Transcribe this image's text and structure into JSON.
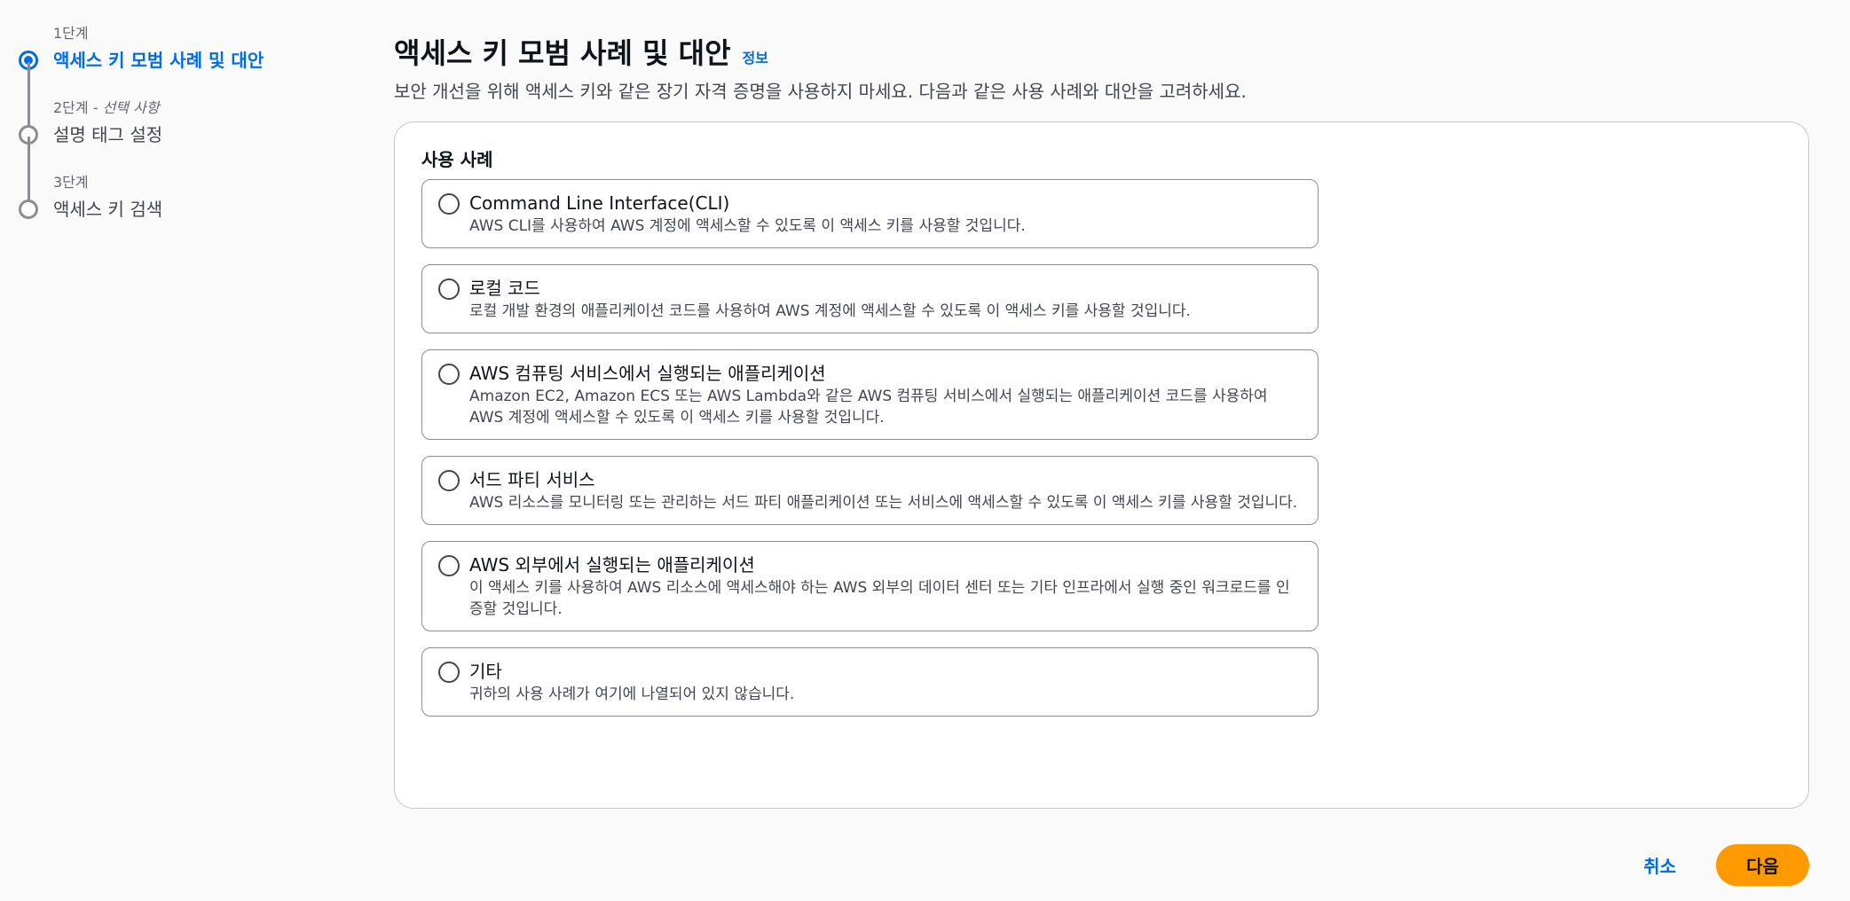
{
  "wizard": {
    "steps": [
      {
        "number": "1단계",
        "optional": "",
        "title": "액세스 키 모범 사례 및 대안",
        "active": true
      },
      {
        "number": "2단계",
        "optional": "선택 사항",
        "title": "설명 태그 설정",
        "active": false
      },
      {
        "number": "3단계",
        "optional": "",
        "title": "액세스 키 검색",
        "active": false
      }
    ]
  },
  "header": {
    "title": "액세스 키 모범 사례 및 대안",
    "info_link": "정보",
    "description": "보안 개선을 위해 액세스 키와 같은 장기 자격 증명을 사용하지 마세요. 다음과 같은 사용 사례와 대안을 고려하세요."
  },
  "use_cases": {
    "label": "사용 사례",
    "options": [
      {
        "title": "Command Line Interface(CLI)",
        "description": "AWS CLI를 사용하여 AWS 계정에 액세스할 수 있도록 이 액세스 키를 사용할 것입니다."
      },
      {
        "title": "로컬 코드",
        "description": "로컬 개발 환경의 애플리케이션 코드를 사용하여 AWS 계정에 액세스할 수 있도록 이 액세스 키를 사용할 것입니다."
      },
      {
        "title": "AWS 컴퓨팅 서비스에서 실행되는 애플리케이션",
        "description": "Amazon EC2, Amazon ECS 또는 AWS Lambda와 같은 AWS 컴퓨팅 서비스에서 실행되는 애플리케이션 코드를 사용하여 AWS 계정에 액세스할 수 있도록 이 액세스 키를 사용할 것입니다."
      },
      {
        "title": "서드 파티 서비스",
        "description": "AWS 리소스를 모니터링 또는 관리하는 서드 파티 애플리케이션 또는 서비스에 액세스할 수 있도록 이 액세스 키를 사용할 것입니다."
      },
      {
        "title": "AWS 외부에서 실행되는 애플리케이션",
        "description": "이 액세스 키를 사용하여 AWS 리소스에 액세스해야 하는 AWS 외부의 데이터 센터 또는 기타 인프라에서 실행 중인 워크로드를 인증할 것입니다."
      },
      {
        "title": "기타",
        "description": "귀하의 사용 사례가 여기에 나열되어 있지 않습니다."
      }
    ]
  },
  "footer": {
    "cancel_label": "취소",
    "next_label": "다음"
  },
  "colors": {
    "accent": "#006ce0",
    "primary_button": "#ff9900"
  }
}
